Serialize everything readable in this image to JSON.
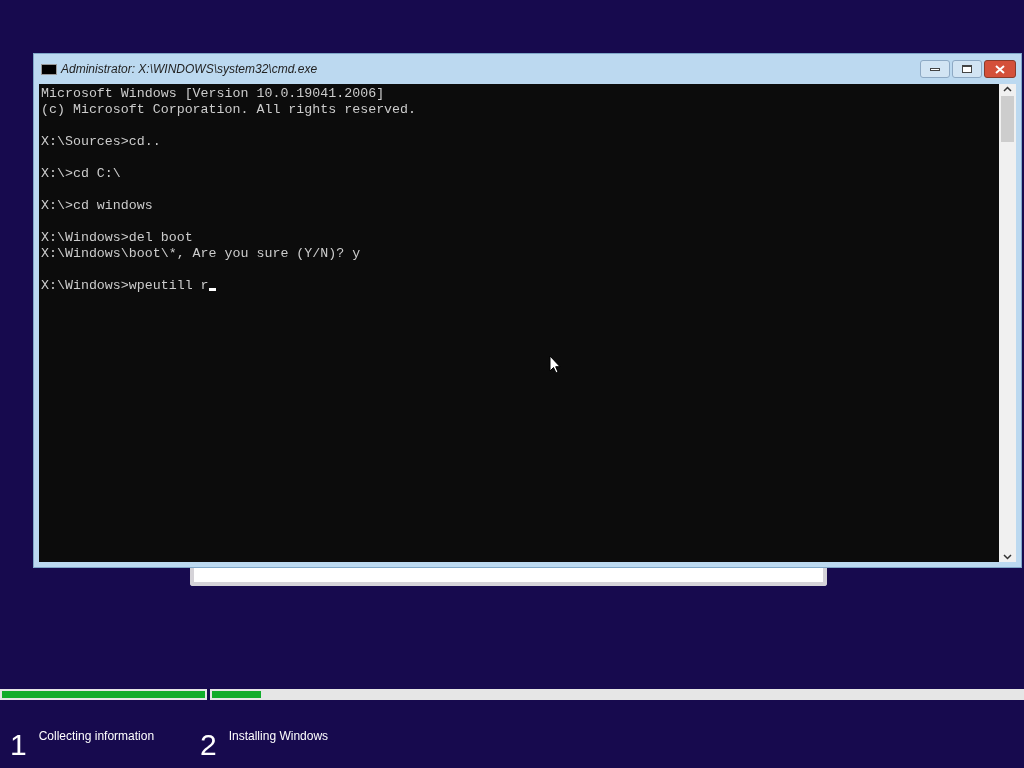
{
  "console_window": {
    "title": "Administrator: X:\\WINDOWS\\system32\\cmd.exe",
    "blocks": [
      [
        "Microsoft Windows [Version 10.0.19041.2006]",
        "(c) Microsoft Corporation. All rights reserved."
      ],
      [
        "X:\\Sources>cd.."
      ],
      [
        "X:\\>cd C:\\"
      ],
      [
        "X:\\>cd windows"
      ],
      [
        "X:\\Windows>del boot",
        "X:\\Windows\\boot\\*, Are you sure (Y/N)? y"
      ],
      [
        "X:\\Windows>wpeutill r"
      ]
    ]
  },
  "steps": [
    {
      "number": "1",
      "label": "Collecting information",
      "level": 1
    },
    {
      "number": "2",
      "label": "Installing Windows",
      "level": 0.06
    }
  ]
}
